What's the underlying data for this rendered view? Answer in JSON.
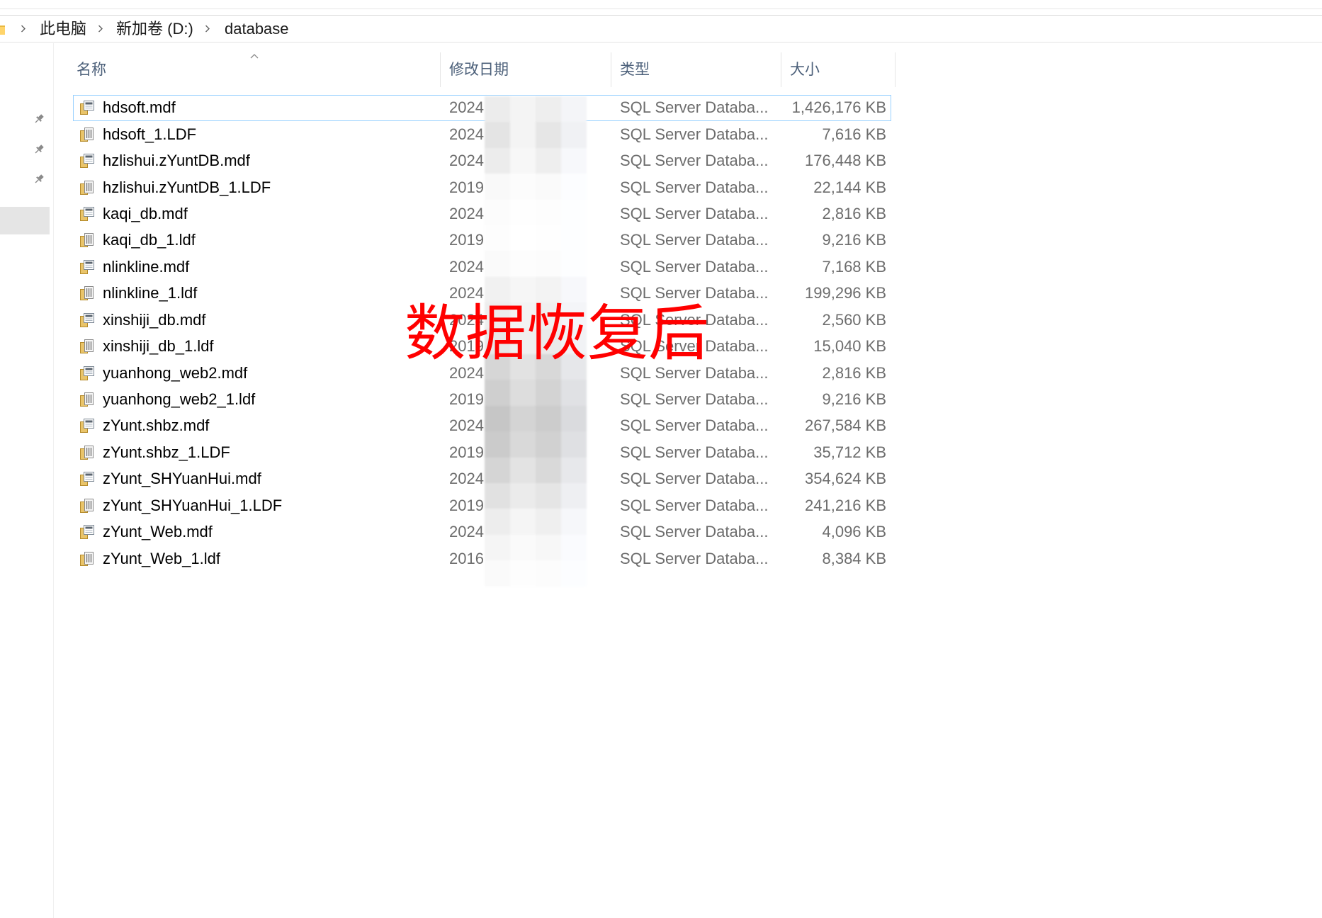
{
  "breadcrumb": {
    "items": [
      "此电脑",
      "新加卷 (D:)",
      "database"
    ]
  },
  "columns": {
    "name": {
      "label": "名称",
      "sort_icon": "sort-ascending-icon"
    },
    "date": {
      "label": "修改日期"
    },
    "type": {
      "label": "类型"
    },
    "size": {
      "label": "大小"
    }
  },
  "files": [
    {
      "name": "hdsoft.mdf",
      "date": "2024",
      "type": "SQL Server Databa...",
      "size": "1,426,176 KB",
      "icon": "mdf-file-icon"
    },
    {
      "name": "hdsoft_1.LDF",
      "date": "2024",
      "type": "SQL Server Databa...",
      "size": "7,616 KB",
      "icon": "ldf-file-icon"
    },
    {
      "name": "hzlishui.zYuntDB.mdf",
      "date": "2024",
      "type": "SQL Server Databa...",
      "size": "176,448 KB",
      "icon": "mdf-file-icon"
    },
    {
      "name": "hzlishui.zYuntDB_1.LDF",
      "date": "2019",
      "type": "SQL Server Databa...",
      "size": "22,144 KB",
      "icon": "ldf-file-icon"
    },
    {
      "name": "kaqi_db.mdf",
      "date": "2024",
      "type": "SQL Server Databa...",
      "size": "2,816 KB",
      "icon": "mdf-file-icon"
    },
    {
      "name": "kaqi_db_1.ldf",
      "date": "2019",
      "type": "SQL Server Databa...",
      "size": "9,216 KB",
      "icon": "ldf-file-icon"
    },
    {
      "name": "nlinkline.mdf",
      "date": "2024",
      "type": "SQL Server Databa...",
      "size": "7,168 KB",
      "icon": "mdf-file-icon"
    },
    {
      "name": "nlinkline_1.ldf",
      "date": "2024",
      "type": "SQL Server Databa...",
      "size": "199,296 KB",
      "icon": "ldf-file-icon"
    },
    {
      "name": "xinshiji_db.mdf",
      "date": "2024",
      "type": "SQL Server Databa...",
      "size": "2,560 KB",
      "icon": "mdf-file-icon"
    },
    {
      "name": "xinshiji_db_1.ldf",
      "date": "2019",
      "type": "SQL Server Databa...",
      "size": "15,040 KB",
      "icon": "ldf-file-icon"
    },
    {
      "name": "yuanhong_web2.mdf",
      "date": "2024",
      "type": "SQL Server Databa...",
      "size": "2,816 KB",
      "icon": "mdf-file-icon"
    },
    {
      "name": "yuanhong_web2_1.ldf",
      "date": "2019",
      "type": "SQL Server Databa...",
      "size": "9,216 KB",
      "icon": "ldf-file-icon"
    },
    {
      "name": "zYunt.shbz.mdf",
      "date": "2024",
      "type": "SQL Server Databa...",
      "size": "267,584 KB",
      "icon": "mdf-file-icon"
    },
    {
      "name": "zYunt.shbz_1.LDF",
      "date": "2019",
      "type": "SQL Server Databa...",
      "size": "35,712 KB",
      "icon": "ldf-file-icon"
    },
    {
      "name": "zYunt_SHYuanHui.mdf",
      "date": "2024",
      "type": "SQL Server Databa...",
      "size": "354,624 KB",
      "icon": "mdf-file-icon"
    },
    {
      "name": "zYunt_SHYuanHui_1.LDF",
      "date": "2019",
      "type": "SQL Server Databa...",
      "size": "241,216 KB",
      "icon": "ldf-file-icon"
    },
    {
      "name": "zYunt_Web.mdf",
      "date": "2024",
      "type": "SQL Server Databa...",
      "size": "4,096 KB",
      "icon": "mdf-file-icon"
    },
    {
      "name": "zYunt_Web_1.ldf",
      "date": "2016",
      "type": "SQL Server Databa...",
      "size": "8,384 KB",
      "icon": "ldf-file-icon"
    }
  ],
  "focused_row": 0,
  "overlay": {
    "text": "数据恢复后"
  },
  "colors": {
    "overlay_text": "#ff0000",
    "focus_outline": "#99d1ff",
    "header_text": "#4c607a",
    "secondary_text": "#6d6d6d",
    "primary_text": "#000000"
  },
  "icons": {
    "breadcrumb_root": "folder-icon",
    "breadcrumb_separator": "chevron-right-icon",
    "nav_pin": "pin-icon",
    "mdf": "mdf-file-icon",
    "ldf": "ldf-file-icon"
  }
}
